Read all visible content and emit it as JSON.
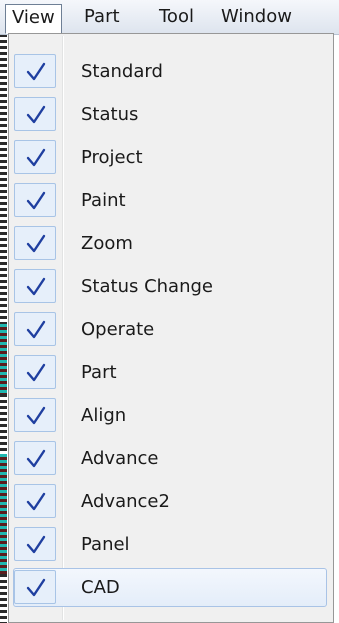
{
  "menubar": {
    "items": [
      {
        "label": "View"
      },
      {
        "label": "Part"
      },
      {
        "label": "Tool"
      },
      {
        "label": "Window"
      }
    ]
  },
  "dropdown": {
    "items": [
      {
        "label": "Standard",
        "checked": true
      },
      {
        "label": "Status",
        "checked": true
      },
      {
        "label": "Project",
        "checked": true
      },
      {
        "label": "Paint",
        "checked": true
      },
      {
        "label": "Zoom",
        "checked": true
      },
      {
        "label": "Status Change",
        "checked": true
      },
      {
        "label": "Operate",
        "checked": true
      },
      {
        "label": "Part",
        "checked": true
      },
      {
        "label": "Align",
        "checked": true
      },
      {
        "label": "Advance",
        "checked": true
      },
      {
        "label": "Advance2",
        "checked": true
      },
      {
        "label": "Panel",
        "checked": true
      },
      {
        "label": "CAD",
        "checked": true,
        "highlighted": true
      }
    ]
  },
  "colors": {
    "check": "#1f3fa0",
    "highlight_border": "#a9c3e6"
  },
  "icons": {
    "check": "check-icon"
  }
}
